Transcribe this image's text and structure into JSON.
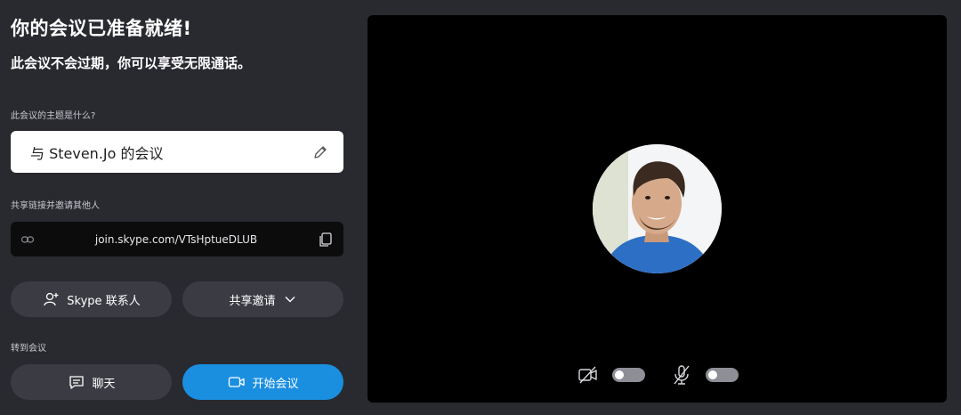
{
  "header": {
    "title": "你的会议已准备就绪!",
    "subtitle": "此会议不会过期，你可以享受无限通话。"
  },
  "topic": {
    "label": "此会议的主题是什么?",
    "value": "与 Steven.Jo 的会议",
    "edit_icon": "pencil-icon"
  },
  "share": {
    "label": "共享链接并邀请其他人",
    "link": "join.skype.com/VTsHptueDLUB",
    "link_icon": "link-icon",
    "copy_icon": "copy-icon"
  },
  "buttons": {
    "skype_contacts": "Skype 联系人",
    "share_invite": "共享邀请"
  },
  "goto": {
    "label": "转到会议",
    "chat": "聊天",
    "start_meeting": "开始会议"
  },
  "preview": {
    "camera_on": false,
    "mic_on": false
  },
  "colors": {
    "background": "#292a30",
    "pill": "#3b3c43",
    "primary": "#1a8fe0",
    "video_bg": "#000000"
  }
}
